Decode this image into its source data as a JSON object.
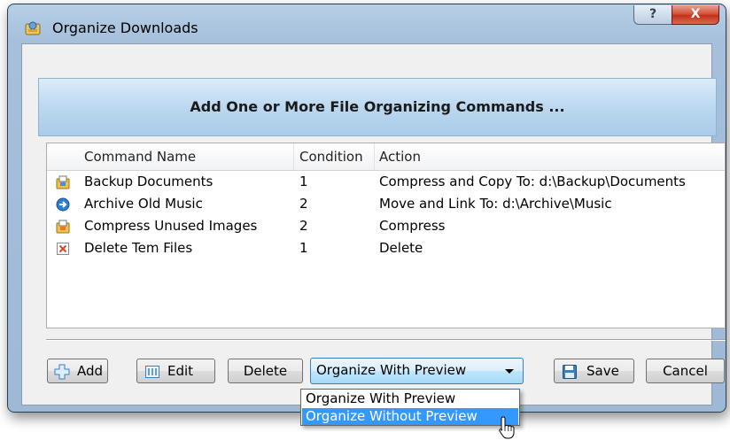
{
  "window": {
    "title": "Organize Downloads",
    "help_label": "?",
    "close_label": "X"
  },
  "banner": {
    "text": "Add One or More File Organizing Commands ..."
  },
  "table": {
    "columns": [
      "Command Name",
      "Condition",
      "Action"
    ],
    "rows": [
      {
        "icon": "organize-icon",
        "name": "Backup Documents",
        "condition": "1",
        "action": "Compress and Copy To: d:\\Backup\\Documents"
      },
      {
        "icon": "arrow-right-circle-icon",
        "name": "Archive Old Music",
        "condition": "2",
        "action": "Move and Link To: d:\\Archive\\Music"
      },
      {
        "icon": "organize-icon",
        "name": "Compress Unused Images",
        "condition": "2",
        "action": "Compress"
      },
      {
        "icon": "delete-x-icon",
        "name": "Delete Tem Files",
        "condition": "1",
        "action": "Delete"
      }
    ]
  },
  "toolbar": {
    "add_label": "Add",
    "edit_label": "Edit",
    "delete_label": "Delete",
    "save_label": "Save",
    "cancel_label": "Cancel"
  },
  "mode_select": {
    "value": "Organize With Preview",
    "options": [
      "Organize With Preview",
      "Organize Without Preview"
    ],
    "highlighted": "Organize Without Preview"
  },
  "colors": {
    "accent_blue": "#3399ff",
    "close_red": "#c3321b",
    "banner_blue": "#bcd8f0"
  }
}
